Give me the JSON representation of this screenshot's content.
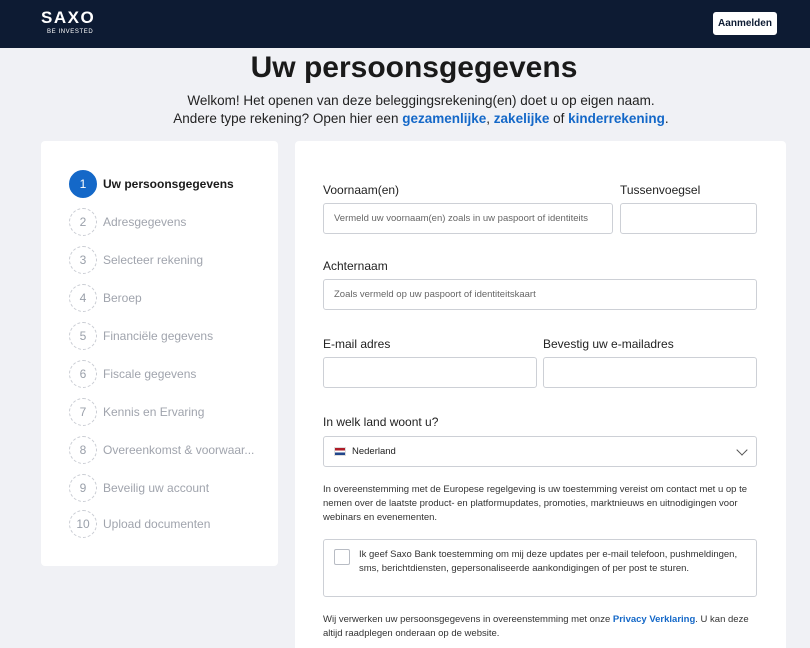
{
  "header": {
    "logo_main": "SAXO",
    "logo_sub": "BE INVESTED",
    "login_label": "Aanmelden"
  },
  "page": {
    "title": "Uw persoonsgegevens",
    "intro_line1": "Welkom! Het openen van deze beleggingsrekening(en) doet u op eigen naam.",
    "intro_line2_prefix": "Andere type rekening? Open hier een",
    "link_joint": "gezamenlijke",
    "sep1": ",",
    "link_business": "zakelijke",
    "sep2": "of",
    "link_child": "kinderrekening",
    "sep3": "."
  },
  "steps": [
    {
      "number": "1",
      "label": "Uw persoonsgegevens",
      "active": true
    },
    {
      "number": "2",
      "label": "Adresgegevens"
    },
    {
      "number": "3",
      "label": "Selecteer rekening"
    },
    {
      "number": "4",
      "label": "Beroep"
    },
    {
      "number": "5",
      "label": "Financiële gegevens"
    },
    {
      "number": "6",
      "label": "Fiscale gegevens"
    },
    {
      "number": "7",
      "label": "Kennis en Ervaring"
    },
    {
      "number": "8",
      "label": "Overeenkomst & voorwaar..."
    },
    {
      "number": "9",
      "label": "Beveilig uw account"
    },
    {
      "number": "10",
      "label": "Upload documenten"
    }
  ],
  "form": {
    "first_name_label": "Voornaam(en)",
    "first_name_placeholder": "Vermeld uw voornaam(en) zoals in uw paspoort of identiteits",
    "infix_label": "Tussenvoegsel",
    "infix_value": "",
    "last_name_label": "Achternaam",
    "last_name_placeholder": "Zoals vermeld op uw paspoort of identiteitskaart",
    "email_label": "E-mail adres",
    "email_value": "",
    "email_confirm_label": "Bevestig uw e-mailadres",
    "email_confirm_value": "",
    "country_label": "In welk land woont u?",
    "country_value": "Nederland",
    "regulation_text": "In overeenstemming met de Europese regelgeving is uw toestemming vereist om contact met u op te nemen over de laatste product- en platformupdates, promoties, marktnieuws en uitnodigingen voor webinars en evenementen.",
    "consent_text": "Ik geef Saxo Bank toestemming om mij deze updates per e-mail telefoon, pushmeldingen, sms, berichtdiensten, gepersonaliseerde aankondigingen of per post te sturen.",
    "consent_checked": false,
    "privacy_prefix": "Wij verwerken uw persoonsgegevens in overeenstemming met onze",
    "privacy_link": "Privacy Verklaring",
    "privacy_suffix": ". U kan deze altijd raadplegen onderaan op de website."
  },
  "colors": {
    "header_bg": "#0d1b33",
    "accent": "#1468c8",
    "page_bg": "#f0f1f5"
  }
}
